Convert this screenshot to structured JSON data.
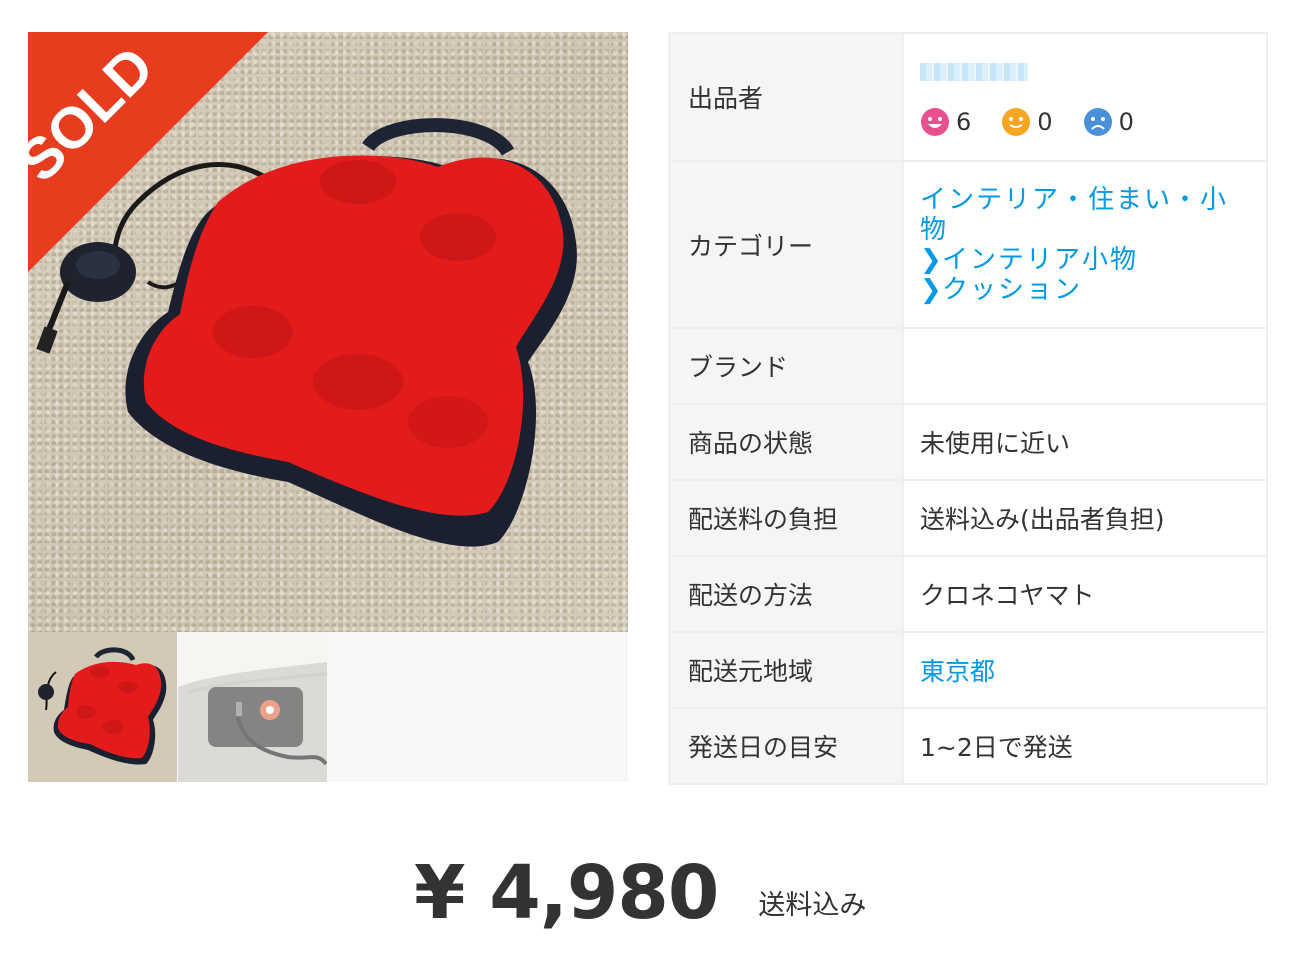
{
  "gallery": {
    "sold_badge": "SOLD",
    "thumbnails": [
      "thumb-1",
      "thumb-2"
    ]
  },
  "details": {
    "seller": {
      "label": "出品者",
      "ratings": {
        "good": "6",
        "normal": "0",
        "bad": "0"
      }
    },
    "category": {
      "label": "カテゴリー",
      "level1": "インテリア・住まい・小物",
      "level2": "インテリア小物",
      "level3": "クッション"
    },
    "brand": {
      "label": "ブランド",
      "value": ""
    },
    "condition": {
      "label": "商品の状態",
      "value": "未使用に近い"
    },
    "shipping_fee": {
      "label": "配送料の負担",
      "value": "送料込み(出品者負担)"
    },
    "shipping_method": {
      "label": "配送の方法",
      "value": "クロネコヤマト"
    },
    "ship_from": {
      "label": "配送元地域",
      "value": "東京都"
    },
    "ship_days": {
      "label": "発送日の目安",
      "value": "1~2日で発送"
    }
  },
  "price": {
    "amount": "¥ 4,980",
    "note": "送料込み"
  },
  "colors": {
    "link": "#0099e8",
    "sold": "#e83c1f",
    "good": "#ea4f8f",
    "normal": "#f5a623",
    "bad": "#4a90d9"
  }
}
